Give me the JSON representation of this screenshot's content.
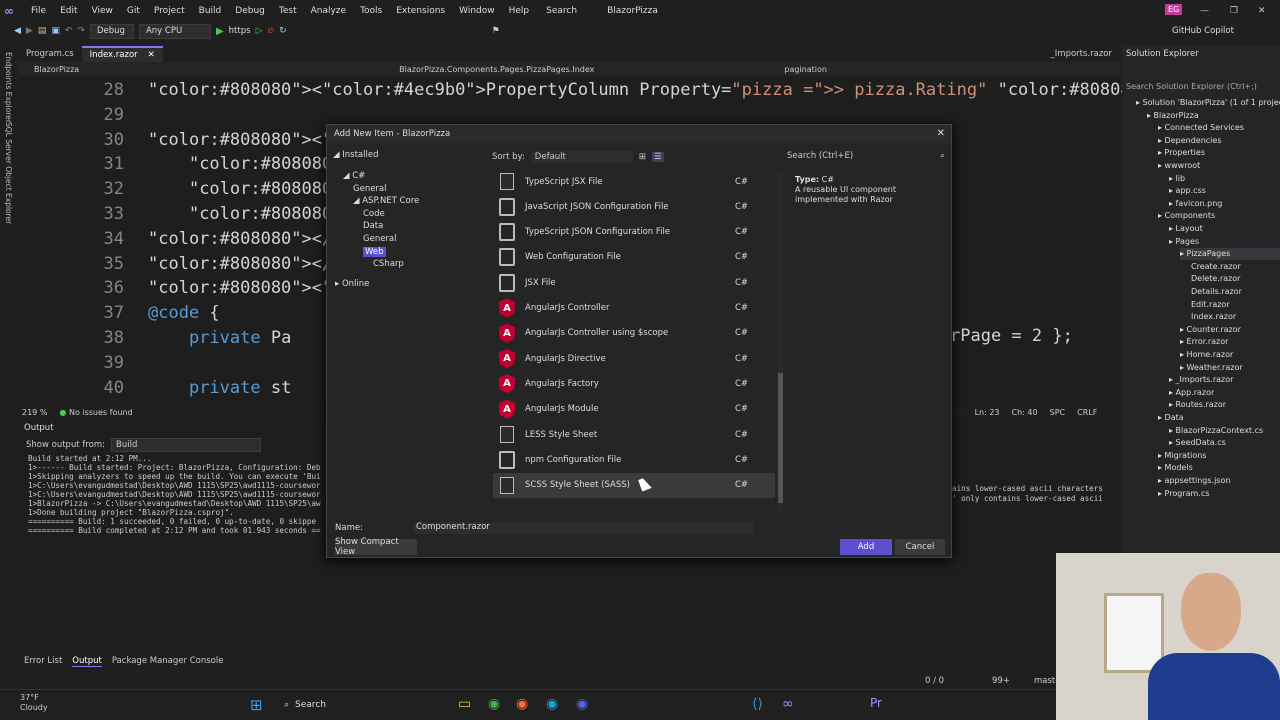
{
  "menu": [
    "File",
    "Edit",
    "View",
    "Git",
    "Project",
    "Build",
    "Debug",
    "Test",
    "Analyze",
    "Tools",
    "Extensions",
    "Window",
    "Help"
  ],
  "search_label": "Search",
  "app_title": "BlazorPizza",
  "user_initials": "EG",
  "copilot": "GitHub Copilot",
  "toolbar": {
    "config": "Debug",
    "platform": "Any CPU",
    "run_target": "https"
  },
  "tabs": [
    "Program.cs",
    "Index.razor",
    "_Imports.razor"
  ],
  "nav": {
    "project": "BlazorPizza",
    "type": "BlazorPizza.Components.Pages.PizzaPages.Index",
    "member": "pagination"
  },
  "code_lines": [
    {
      "n": "28",
      "text": "<PropertyColumn Property=\"pizza => pizza.Rating\" />"
    },
    {
      "n": "29",
      "text": ""
    },
    {
      "n": "30",
      "text": "<TemplateC"
    },
    {
      "n": "31",
      "text": "    <a hre"
    },
    {
      "n": "32",
      "text": "    <a hre"
    },
    {
      "n": "33",
      "text": "    <a hre"
    },
    {
      "n": "34",
      "text": "</Template"
    },
    {
      "n": "35",
      "text": "</QuickGrid>"
    },
    {
      "n": "36",
      "text": "<Paginator Sta"
    },
    {
      "n": "37",
      "text": "@code {"
    },
    {
      "n": "38",
      "text": "    private Pa"
    },
    {
      "n": "39",
      "text": ""
    },
    {
      "n": "40",
      "text": "    private st"
    }
  ],
  "code_right": "rPage = 2 };",
  "editor_status": {
    "zoom": "219 %",
    "issues": "No issues found",
    "pos": "Ln: 23",
    "col": "Ch: 40",
    "spc": "SPC",
    "crlf": "CRLF"
  },
  "output": {
    "title": "Output",
    "show_from_label": "Show output from:",
    "source": "Build",
    "lines": [
      "Build started at 2:12 PM...",
      "1>------ Build started: Project: BlazorPizza, Configuration: Deb",
      "1>Skipping analyzers to speed up the build. You can execute 'Bui",
      "1>C:\\Users\\evangudmestad\\Desktop\\AWD 1115\\SP25\\awd1115-coursewor",
      "1>C:\\Users\\evangudmestad\\Desktop\\AWD 1115\\SP25\\awd1115-coursewor",
      "1>BlazorPizza -> C:\\Users\\evangudmestad\\Desktop\\AWD 1115\\SP25\\aw",
      "1>Done building project \"BlazorPizza.csproj\".",
      "========== Build: 1 succeeded, 0 failed, 0 up-to-date, 0 skippe",
      "========== Build completed at 2:12 PM and took 01.943 seconds =="
    ],
    "right1": "ains lower-cased ascii characters",
    "right2": "' only contains lower-cased ascii"
  },
  "bottom_tabs": [
    "Error List",
    "Output",
    "Package Manager Console"
  ],
  "solution_explorer": {
    "title": "Solution Explorer",
    "search": "Search Solution Explorer (Ctrl+;)",
    "items": [
      {
        "t": "Solution 'BlazorPizza' (1 of 1 project)",
        "d": 0
      },
      {
        "t": "BlazorPizza",
        "d": 1
      },
      {
        "t": "Connected Services",
        "d": 2
      },
      {
        "t": "Dependencies",
        "d": 2
      },
      {
        "t": "Properties",
        "d": 2
      },
      {
        "t": "wwwroot",
        "d": 2
      },
      {
        "t": "lib",
        "d": 3
      },
      {
        "t": "app.css",
        "d": 3
      },
      {
        "t": "favicon.png",
        "d": 3
      },
      {
        "t": "Components",
        "d": 2
      },
      {
        "t": "Layout",
        "d": 3
      },
      {
        "t": "Pages",
        "d": 3
      },
      {
        "t": "PizzaPages",
        "d": 4
      },
      {
        "t": "Create.razor",
        "d": 5
      },
      {
        "t": "Delete.razor",
        "d": 5
      },
      {
        "t": "Details.razor",
        "d": 5
      },
      {
        "t": "Edit.razor",
        "d": 5
      },
      {
        "t": "Index.razor",
        "d": 5
      },
      {
        "t": "Counter.razor",
        "d": 4
      },
      {
        "t": "Error.razor",
        "d": 4
      },
      {
        "t": "Home.razor",
        "d": 4
      },
      {
        "t": "Weather.razor",
        "d": 4
      },
      {
        "t": "_Imports.razor",
        "d": 3
      },
      {
        "t": "App.razor",
        "d": 3
      },
      {
        "t": "Routes.razor",
        "d": 3
      },
      {
        "t": "Data",
        "d": 2
      },
      {
        "t": "BlazorPizzaContext.cs",
        "d": 3
      },
      {
        "t": "SeedData.cs",
        "d": 3
      },
      {
        "t": "Migrations",
        "d": 2
      },
      {
        "t": "Models",
        "d": 2
      },
      {
        "t": "appsettings.json",
        "d": 2
      },
      {
        "t": "Program.cs",
        "d": 2
      }
    ]
  },
  "dialog": {
    "title": "Add New Item - BlazorPizza",
    "installed": "Installed",
    "sort_label": "Sort by:",
    "sort_value": "Default",
    "search": "Search (Ctrl+E)",
    "tree": [
      {
        "t": "C#",
        "d": 0
      },
      {
        "t": "General",
        "d": 1
      },
      {
        "t": "ASP.NET Core",
        "d": 1
      },
      {
        "t": "Code",
        "d": 2
      },
      {
        "t": "Data",
        "d": 2
      },
      {
        "t": "General",
        "d": 2
      },
      {
        "t": "Web",
        "d": 2
      },
      {
        "t": "CSharp",
        "d": 3
      },
      {
        "t": "Online",
        "d": -1
      }
    ],
    "templates": [
      {
        "name": "TypeScript JSX File",
        "lang": "C#",
        "icon": "file"
      },
      {
        "name": "JavaScript JSON Configuration File",
        "lang": "C#",
        "icon": "cfg"
      },
      {
        "name": "TypeScript JSON Configuration File",
        "lang": "C#",
        "icon": "cfg"
      },
      {
        "name": "Web Configuration File",
        "lang": "C#",
        "icon": "cfg"
      },
      {
        "name": "JSX File",
        "lang": "C#",
        "icon": "cfg"
      },
      {
        "name": "AngularJs Controller",
        "lang": "C#",
        "icon": "angular"
      },
      {
        "name": "AngularJs Controller using $scope",
        "lang": "C#",
        "icon": "angular"
      },
      {
        "name": "AngularJs Directive",
        "lang": "C#",
        "icon": "angular"
      },
      {
        "name": "AngularJs Factory",
        "lang": "C#",
        "icon": "angular"
      },
      {
        "name": "AngularJs Module",
        "lang": "C#",
        "icon": "angular"
      },
      {
        "name": "LESS Style Sheet",
        "lang": "C#",
        "icon": "file"
      },
      {
        "name": "npm Configuration File",
        "lang": "C#",
        "icon": "cfg"
      },
      {
        "name": "SCSS Style Sheet (SASS)",
        "lang": "C#",
        "icon": "file"
      }
    ],
    "detail_type_label": "Type:",
    "detail_type": "C#",
    "detail_desc": "A reusable UI component implemented with Razor",
    "name_label": "Name:",
    "name_value": "Component.razor",
    "compact": "Show Compact View",
    "add": "Add",
    "cancel": "Cancel"
  },
  "status": {
    "lines": "0 / 0",
    "count": "99+",
    "branch": "maste"
  },
  "weather": {
    "temp": "37°F",
    "cond": "Cloudy"
  },
  "taskbar_search": "Search",
  "colors": {
    "accent": "#8a74f0",
    "add_button": "#5b4fcf",
    "angular": "#c3002f"
  }
}
